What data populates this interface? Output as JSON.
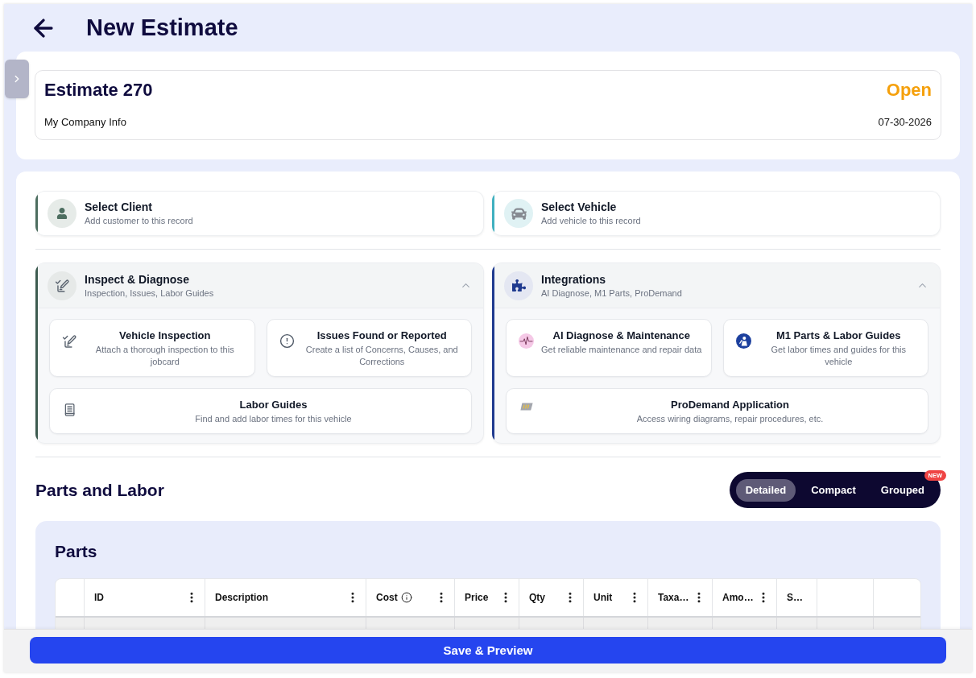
{
  "header": {
    "title": "New Estimate"
  },
  "estimate": {
    "title": "Estimate 270",
    "status": "Open",
    "company": "My Company Info",
    "date": "07-30-2026"
  },
  "selectors": [
    {
      "kind": "client",
      "title": "Select Client",
      "subtitle": "Add customer to this record",
      "color": "#4d6e60"
    },
    {
      "kind": "vehicle",
      "title": "Select Vehicle",
      "subtitle": "Add vehicle to this record",
      "color": "#3fb0bf"
    }
  ],
  "sections": [
    {
      "kind": "inspect",
      "title": "Inspect & Diagnose",
      "subtitle": "Inspection, Issues, Labor Guides",
      "color": "#3d5c50",
      "expanded": true,
      "items": [
        {
          "kind": "inspection",
          "title": "Vehicle Inspection",
          "description": "Attach a thorough inspection to this jobcard"
        },
        {
          "kind": "issues",
          "title": "Issues Found or Reported",
          "description": "Create a list of Concerns, Causes, and Corrections"
        },
        {
          "kind": "labor",
          "title": "Labor Guides",
          "description": "Find and add labor times for this vehicle"
        }
      ]
    },
    {
      "kind": "integrations",
      "title": "Integrations",
      "subtitle": "AI Diagnose, M1 Parts, ProDemand",
      "color": "#1f3a8f",
      "expanded": true,
      "items": [
        {
          "kind": "ai",
          "title": "AI Diagnose & Maintenance",
          "description": "Get reliable maintenance and repair data"
        },
        {
          "kind": "m1",
          "title": "M1 Parts & Labor Guides",
          "description": "Get labor times and guides for this vehicle"
        },
        {
          "kind": "prodemand",
          "title": "ProDemand Application",
          "description": "Access wiring diagrams, repair procedures, etc."
        }
      ]
    }
  ],
  "parts_and_labor": {
    "title": "Parts and Labor",
    "views": [
      {
        "label": "Detailed",
        "selected": true
      },
      {
        "label": "Compact",
        "selected": false
      },
      {
        "label": "Grouped",
        "selected": false,
        "badge": "NEW"
      }
    ]
  },
  "parts": {
    "title": "Parts",
    "columns": [
      {
        "kind": "blank"
      },
      {
        "kind": "data",
        "label": "ID",
        "menu": true,
        "info": false
      },
      {
        "kind": "data",
        "label": "Description",
        "menu": true,
        "info": false
      },
      {
        "kind": "data",
        "label": "Cost",
        "menu": true,
        "info": true
      },
      {
        "kind": "data",
        "label": "Price",
        "menu": true,
        "info": false
      },
      {
        "kind": "data",
        "label": "Qty",
        "menu": true,
        "info": false
      },
      {
        "kind": "data",
        "label": "Unit",
        "menu": true,
        "info": false
      },
      {
        "kind": "data",
        "label": "Taxa…",
        "menu": true,
        "info": false
      },
      {
        "kind": "data",
        "label": "Amo…",
        "menu": true,
        "info": false
      },
      {
        "kind": "data",
        "label": "S…",
        "menu": false,
        "info": false
      },
      {
        "kind": "blank"
      },
      {
        "kind": "blank"
      }
    ]
  },
  "footer": {
    "button": "Save & Preview"
  }
}
